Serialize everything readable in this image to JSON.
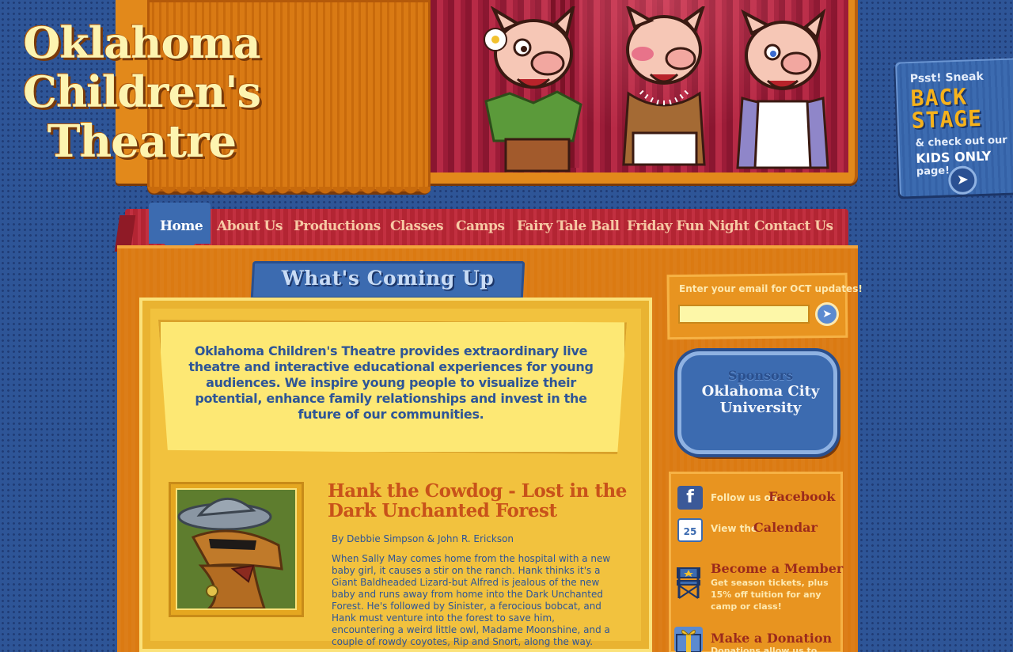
{
  "logo": {
    "line1": "Oklahoma",
    "line2": "Children's",
    "line3": "Theatre"
  },
  "backstage": {
    "psst": "Psst! Sneak",
    "back": "BACK",
    "stage": "STAGE",
    "line1": "& check out our",
    "line2": "KIDS ONLY",
    "line3": "page!",
    "arrow": "➤"
  },
  "nav": {
    "items": [
      {
        "label": "Home",
        "active": true
      },
      {
        "label": "About Us"
      },
      {
        "label": "Productions"
      },
      {
        "label": "Classes"
      },
      {
        "label": "Camps"
      },
      {
        "label": "Fairy Tale Ball"
      },
      {
        "label": "Friday Fun Night"
      },
      {
        "label": "Contact Us"
      }
    ]
  },
  "main": {
    "section_title": "What's Coming Up",
    "mission": "Oklahoma Children's Theatre provides extraordinary live theatre and interactive educational experiences for young audiences. We inspire young people to visualize their potential, enhance family relationships and invest in the future of our communities.",
    "show": {
      "title": "Hank the Cowdog - Lost in the Dark Unchanted Forest",
      "byline": "By Debbie Simpson & John R. Erickson",
      "description": "When Sally May comes home from the hospital with a new baby girl, it causes a stir on the ranch.  Hank thinks it's a Giant Baldheaded Lizard-but Alfred is jealous of the new baby and runs away from home into the Dark Unchanted Forest.  He's followed by Sinister, a ferocious bobcat, and Hank must venture into the forest to save him, encountering a weird little owl, Madame Moonshine, and a couple of rowdy coyotes, Rip and Snort, along the way."
    }
  },
  "sidebar": {
    "email_label": "Enter your email for OCT updates!",
    "email_value": "",
    "email_go": "➤",
    "sponsors_label": "Sponsors",
    "sponsor_name": "Oklahoma City University",
    "facebook_small": "Follow us on",
    "facebook_big": "Facebook",
    "facebook_icon": "f",
    "calendar_small": "View the",
    "calendar_big": "Calendar",
    "calendar_icon": "25",
    "member_title": "Become a Member",
    "member_desc": "Get season tickets, plus 15% off tuition for any camp or class!",
    "donation_title": "Make a Donation",
    "donation_desc": "Donations allow us to"
  },
  "colors": {
    "background_blue": "#2e5597",
    "orange": "#db7a12",
    "nav_red": "#b32533",
    "tab_blue": "#3c6bb0",
    "cream_text": "#fdf4b0",
    "headline_rust": "#c8521a"
  }
}
